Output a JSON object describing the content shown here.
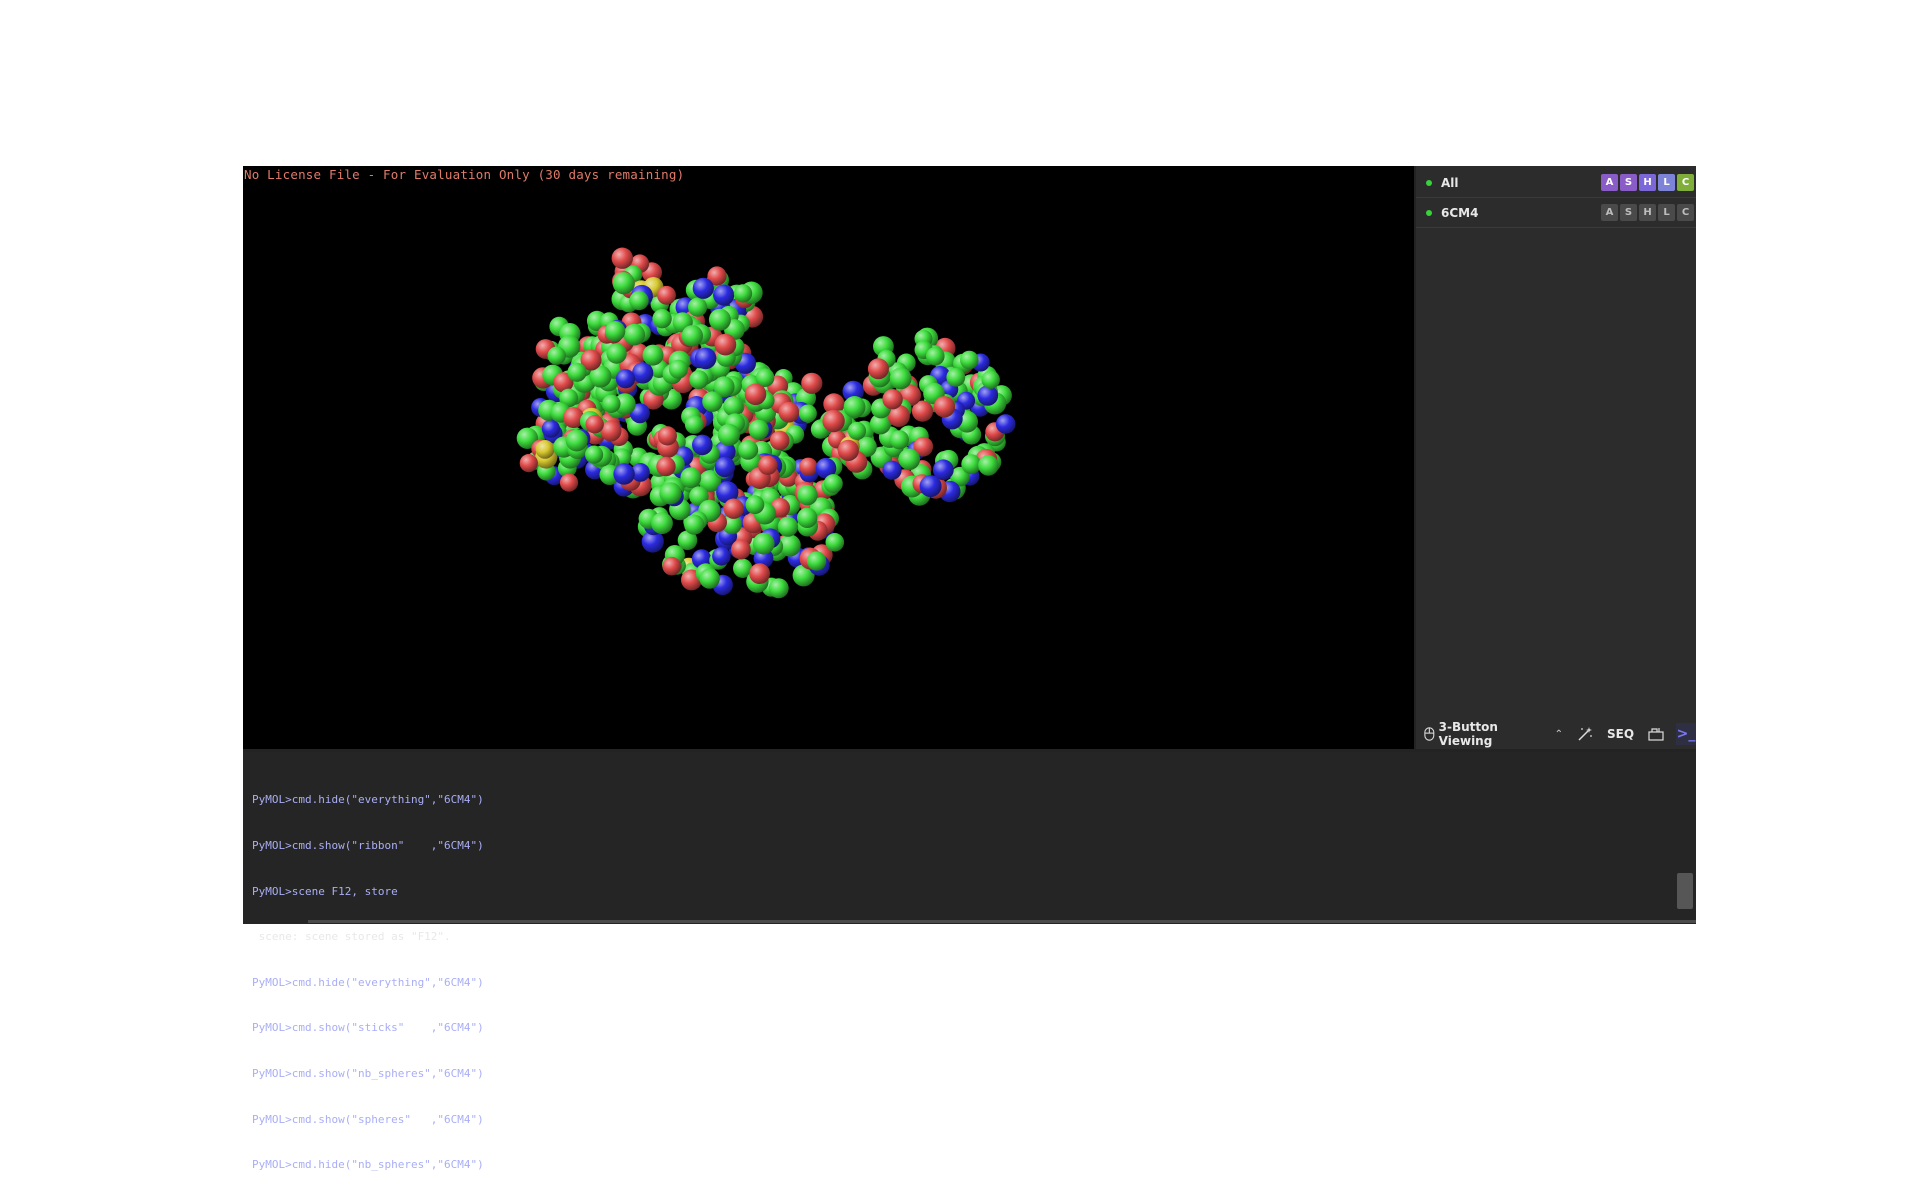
{
  "viewer": {
    "license_text": "No License File - For Evaluation Only (30 days remaining)"
  },
  "object_panel": {
    "rows": [
      {
        "name": "All",
        "buttons": [
          "A",
          "S",
          "H",
          "L",
          "C"
        ],
        "button_colors": [
          "#8a5cc7",
          "#8a5cc7",
          "#7b67d8",
          "#7d84d8",
          "#7fae3a"
        ]
      },
      {
        "name": "6CM4",
        "buttons": [
          "A",
          "S",
          "H",
          "L",
          "C"
        ]
      }
    ]
  },
  "toolbar": {
    "viewing_mode": "3-Button Viewing",
    "seq_label": "SEQ",
    "icons": [
      "mouse-icon",
      "chevron-up-icon",
      "wizard-icon",
      "builder-icon",
      "terminal-icon"
    ]
  },
  "console": {
    "lines": [
      {
        "kind": "cmd",
        "text": "PyMOL>cmd.hide(\"everything\",\"6CM4\")"
      },
      {
        "kind": "cmd",
        "text": "PyMOL>cmd.show(\"ribbon\"    ,\"6CM4\")"
      },
      {
        "kind": "cmd",
        "text": "PyMOL>scene F12, store"
      },
      {
        "kind": "out",
        "text": " scene: scene stored as \"F12\"."
      },
      {
        "kind": "cmd",
        "text": "PyMOL>cmd.hide(\"everything\",\"6CM4\")"
      },
      {
        "kind": "cmd",
        "text": "PyMOL>cmd.show(\"sticks\"    ,\"6CM4\")"
      },
      {
        "kind": "cmd",
        "text": "PyMOL>cmd.show(\"nb_spheres\",\"6CM4\")"
      },
      {
        "kind": "cmd",
        "text": "PyMOL>cmd.show(\"spheres\"   ,\"6CM4\")"
      },
      {
        "kind": "cmd",
        "text": "PyMOL>cmd.hide(\"nb_spheres\",\"6CM4\")"
      }
    ]
  },
  "colors": {
    "carbon": "#3ddc3d",
    "oxygen": "#e04a4a",
    "nitrogen": "#2b2be0",
    "sulfur": "#d8c830",
    "background": "#000000"
  }
}
